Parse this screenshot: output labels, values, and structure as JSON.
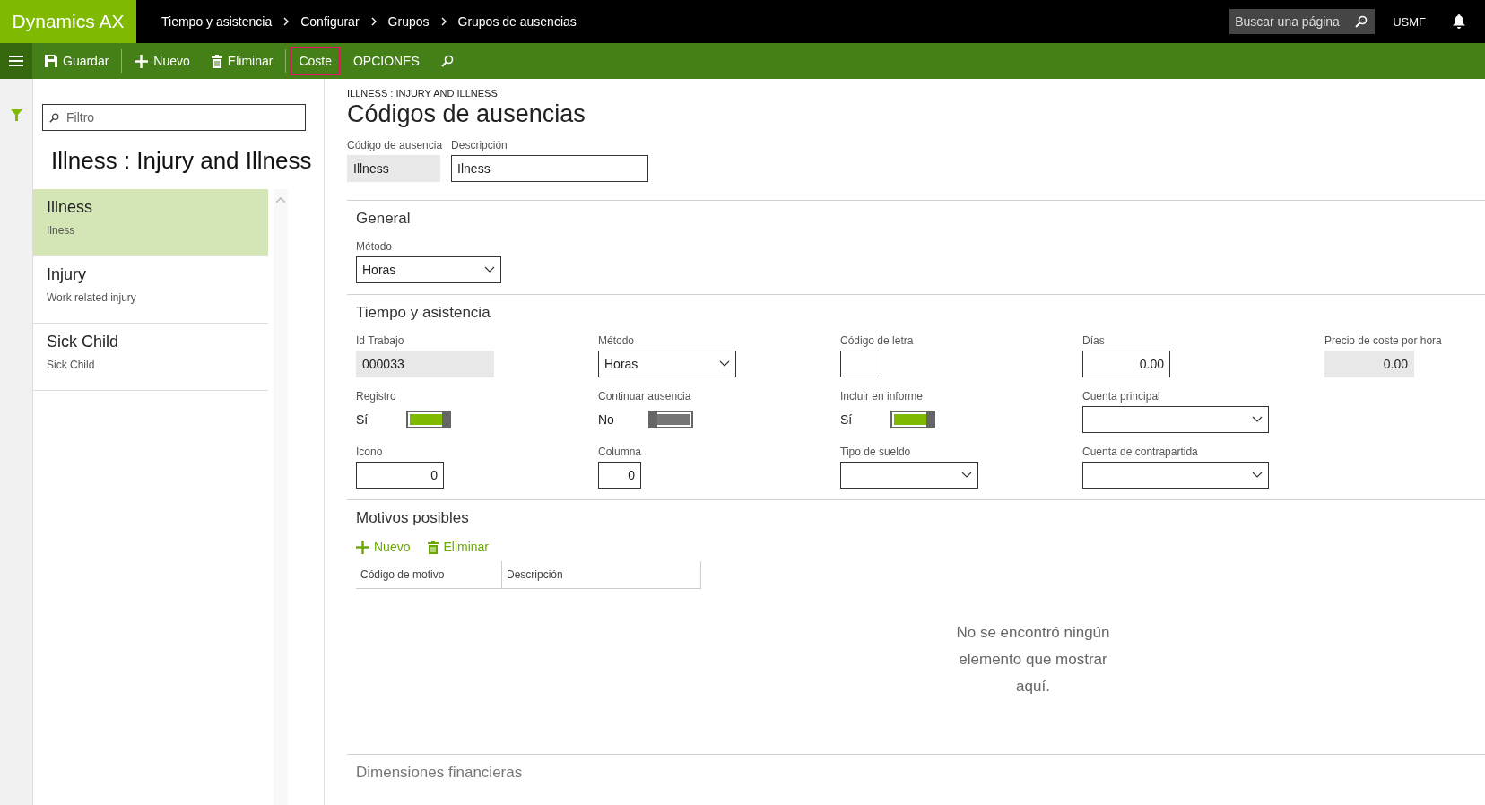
{
  "app_title": "Dynamics AX",
  "breadcrumb": [
    "Tiempo y asistencia",
    "Configurar",
    "Grupos",
    "Grupos de ausencias"
  ],
  "page_search": {
    "placeholder": "Buscar una página"
  },
  "company": "USMF",
  "action_groups": [
    [
      {
        "kind": "save",
        "label": "Guardar",
        "highlighted": false
      }
    ],
    [
      {
        "kind": "add",
        "label": "Nuevo",
        "highlighted": false
      },
      {
        "kind": "delete",
        "label": "Eliminar",
        "highlighted": false
      }
    ],
    [
      {
        "kind": "text",
        "label": "Coste",
        "highlighted": true
      },
      {
        "kind": "text",
        "label": "OPCIONES",
        "highlighted": false
      },
      {
        "kind": "search",
        "highlighted": false
      }
    ]
  ],
  "filter": {
    "placeholder": "Filtro"
  },
  "list_title": "Illness : Injury and Illness",
  "list_items": [
    {
      "title": "Illness",
      "subtitle": "Ilness",
      "selected": true
    },
    {
      "title": "Injury",
      "subtitle": "Work related injury",
      "selected": false
    },
    {
      "title": "Sick Child",
      "subtitle": "Sick Child",
      "selected": false
    }
  ],
  "caption": "ILLNESS : INJURY AND ILLNESS",
  "title": "Códigos de ausencias",
  "header_fields": [
    {
      "kind": "readonly",
      "label": "Código de ausencia",
      "value": "Illness"
    },
    {
      "kind": "input",
      "label": "Descripción",
      "value": "Ilness"
    }
  ],
  "general": {
    "title": "General",
    "fields": [
      {
        "kind": "select",
        "label": "Método",
        "value": "Horas"
      }
    ]
  },
  "time_attendance": {
    "title": "Tiempo y asistencia",
    "columns": [
      [
        {
          "kind": "readonly",
          "label": "Id Trabajo",
          "value": "000033"
        },
        {
          "kind": "toggle",
          "label": "Registro",
          "value": "Sí",
          "on": true
        },
        {
          "kind": "number",
          "label": "Icono",
          "value": "0"
        }
      ],
      [
        {
          "kind": "select",
          "label": "Método",
          "value": "Horas"
        },
        {
          "kind": "toggle",
          "label": "Continuar ausencia",
          "value": "No",
          "on": false
        },
        {
          "kind": "number",
          "label": "Columna",
          "value": "0"
        }
      ],
      [
        {
          "kind": "input",
          "label": "Código de letra"
        },
        {
          "kind": "toggle",
          "label": "Incluir en informe",
          "value": "Sí",
          "on": true
        },
        {
          "kind": "select",
          "label": "Tipo de sueldo"
        }
      ],
      [
        {
          "kind": "number",
          "label": "Días",
          "value": "0.00"
        },
        {
          "kind": "select",
          "label": "Cuenta principal"
        },
        {
          "kind": "select",
          "label": "Cuenta de contrapartida"
        }
      ],
      [
        {
          "kind": "readonly_number",
          "label": "Precio de coste por hora",
          "value": "0.00"
        }
      ]
    ]
  },
  "reasons": {
    "title": "Motivos posibles",
    "actions": [
      {
        "kind": "add",
        "label": "Nuevo"
      },
      {
        "kind": "delete",
        "label": "Eliminar"
      }
    ],
    "columns": [
      "Código de motivo",
      "Descripción"
    ],
    "empty_message": "No se encontró ningún elemento que mostrar aquí."
  },
  "financial_dimensions": {
    "title": "Dimensiones financieras"
  }
}
